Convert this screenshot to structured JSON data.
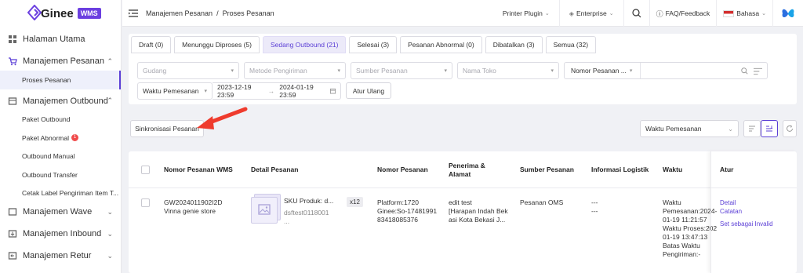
{
  "brand": {
    "name": "Ginee",
    "badge": "WMS",
    "color": "#6b3fe0"
  },
  "sidebar": {
    "items": [
      {
        "label": "Halaman Utama",
        "icon": "dashboard-icon"
      },
      {
        "label": "Manajemen Pesanan",
        "icon": "cart-icon",
        "expanded": true,
        "children": [
          {
            "label": "Proses Pesanan",
            "active": true
          }
        ]
      },
      {
        "label": "Manajemen Outbound",
        "icon": "box-icon",
        "expanded": true,
        "children": [
          {
            "label": "Paket Outbound"
          },
          {
            "label": "Paket Abnormal",
            "badge": "1"
          },
          {
            "label": "Outbound Manual"
          },
          {
            "label": "Outbound Transfer"
          },
          {
            "label": "Cetak Label Pengiriman Item T..."
          }
        ]
      },
      {
        "label": "Manajemen Wave",
        "icon": "wave-icon"
      },
      {
        "label": "Manajemen Inbound",
        "icon": "inbound-icon"
      },
      {
        "label": "Manajemen Retur",
        "icon": "return-icon"
      }
    ]
  },
  "header": {
    "breadcrumb": [
      "Manajemen Pesanan",
      "/",
      "Proses Pesanan"
    ],
    "printer_plugin": "Printer Plugin",
    "enterprise": "Enterprise",
    "faq": "FAQ/Feedback",
    "language": "Bahasa"
  },
  "tabs": [
    {
      "label": "Draft (0)"
    },
    {
      "label": "Menunggu Diproses (5)"
    },
    {
      "label": "Sedang Outbound (21)",
      "active": true
    },
    {
      "label": "Selesai (3)"
    },
    {
      "label": "Pesanan Abnormal (0)"
    },
    {
      "label": "Dibatalkan (3)"
    },
    {
      "label": "Semua (32)"
    }
  ],
  "filters": {
    "gudang": "Gudang",
    "metode": "Metode Pengiriman",
    "sumber": "Sumber Pesanan",
    "nama_toko": "Nama Toko",
    "nomor_pesanan": "Nomor Pesanan ...",
    "waktu_label": "Waktu Pemesanan",
    "date_start": "2023-12-19 23:59",
    "date_sep": "→",
    "date_end": "2024-01-19 23:59",
    "reset": "Atur Ulang"
  },
  "toolbar": {
    "sync": "Sinkronisasi Pesanan",
    "sort_by": "Waktu Pemesanan"
  },
  "table": {
    "columns": [
      "Nomor Pesanan WMS",
      "Detail Pesanan",
      "Nomor Pesanan",
      "Penerima & Alamat",
      "Sumber Pesanan",
      "Informasi Logistik",
      "Waktu",
      "Atur"
    ],
    "rows": [
      {
        "wms_no": "GW2024011902I2D",
        "store": "Vinna genie store",
        "sku": "SKU Produk: d...",
        "sku_code": "dsftest0118001",
        "sku_more": "...",
        "qty": "x12",
        "platform": "Platform:1720",
        "ginee_no": "Ginee:So-17481991",
        "ginee_no2": "83418085376",
        "recipient": "edit test",
        "address1": "[Harapan Indah Bek",
        "address2": "asi Kota Bekasi J...",
        "source": "Pesanan OMS",
        "logistics1": "---",
        "logistics2": "---",
        "time_lines": [
          "Waktu",
          "Pemesanan:2024-",
          "01-19 11:21:57",
          "Waktu Proses:202",
          "01-19 13:47:13",
          "Batas Waktu",
          "Pengiriman:-"
        ],
        "actions": [
          "Detail",
          "Catatan",
          "Set sebagai Invalid"
        ]
      }
    ]
  },
  "colors": {
    "accent": "#5b3fd6",
    "arrow": "#ef3b2d"
  }
}
